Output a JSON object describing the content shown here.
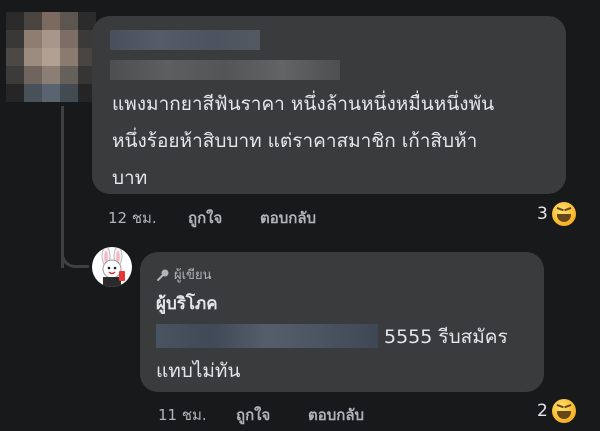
{
  "comment": {
    "text_lines": [
      "แพงมากยาสีฟันราคา หนึ่งล้านหนึ่งหมื่นหนึ่งพัน",
      "หนึ่งร้อยห้าสิบบาท แต่ราคาสมาชิก เก้าสิบห้า",
      "บาท"
    ],
    "time": "12 ชม.",
    "like_label": "ถูกใจ",
    "reply_label": "ตอบกลับ",
    "reaction_count": "3",
    "reaction_icon": "haha-emoji-icon"
  },
  "reply": {
    "badge": "ผู้เขียน",
    "author": "ผู้บริโภค",
    "line1_visible": "5555 รีบสมัคร",
    "line2": "แทบไม่ทัน",
    "time": "11 ชม.",
    "like_label": "ถูกใจ",
    "reply_label": "ตอบกลับ",
    "reaction_count": "2",
    "reaction_icon": "haha-emoji-icon"
  },
  "colors": {
    "background": "#18191a",
    "bubble": "#3a3b3c",
    "text": "#e4e6eb",
    "secondary_text": "#b0b3b8"
  }
}
